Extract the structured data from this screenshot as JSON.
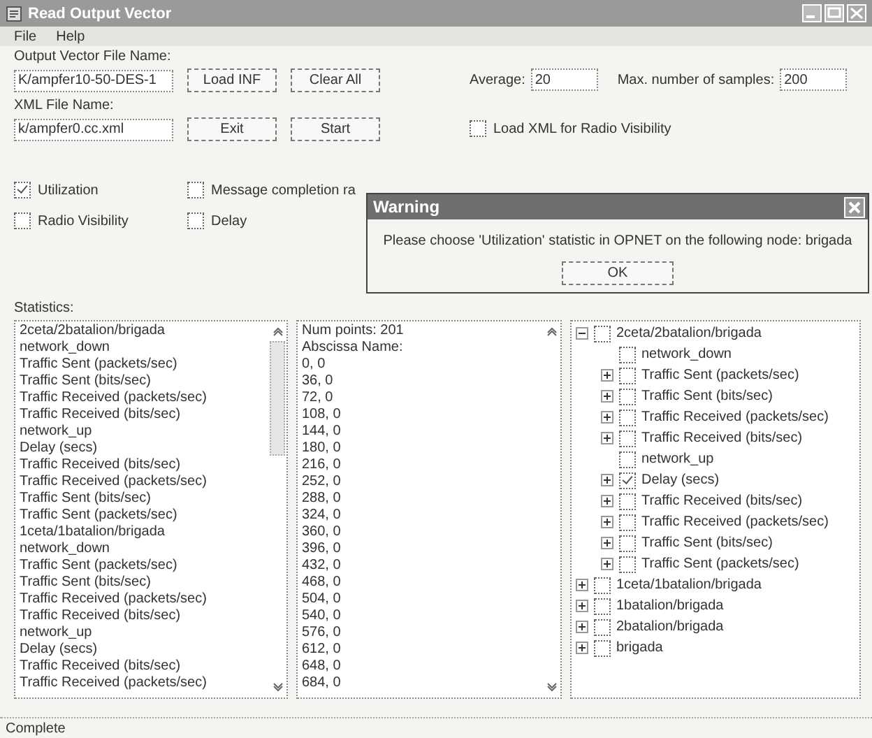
{
  "window": {
    "title": "Read Output Vector"
  },
  "menu": [
    "File",
    "Help"
  ],
  "output_vector": {
    "label": "Output Vector File Name:",
    "value": "K/ampfer10-50-DES-1"
  },
  "xml_file": {
    "label": "XML File Name:",
    "value": "k/ampfer0.cc.xml"
  },
  "buttons": [
    "Load INF",
    "Clear All",
    "Exit",
    "Start"
  ],
  "average": {
    "label": "Average:",
    "value": "20"
  },
  "max_samples": {
    "label": "Max. number of samples:",
    "value": "200"
  },
  "load_xml": {
    "label": "Load XML for Radio Visibility",
    "checked": false
  },
  "options": [
    {
      "label": "Utilization",
      "checked": true
    },
    {
      "label": "Message completion ra",
      "checked": false
    },
    {
      "label": "Radio Visibility",
      "checked": false
    },
    {
      "label": "Delay",
      "checked": false
    }
  ],
  "statistics": {
    "label": "Statistics:",
    "items": [
      "2ceta/2batalion/brigada",
      "network_down",
      "Traffic Sent (packets/sec)",
      "Traffic Sent (bits/sec)",
      "Traffic Received (packets/sec)",
      "Traffic Received (bits/sec)",
      "network_up",
      "Delay (secs)",
      "Traffic Received (bits/sec)",
      "Traffic Received (packets/sec)",
      "Traffic Sent (bits/sec)",
      "Traffic Sent (packets/sec)",
      "1ceta/1batalion/brigada",
      "network_down",
      "Traffic Sent (packets/sec)",
      "Traffic Sent (bits/sec)",
      "Traffic Received (packets/sec)",
      "Traffic Received (bits/sec)",
      "network_up",
      "Delay (secs)",
      "Traffic Received (bits/sec)",
      "Traffic Received (packets/sec)"
    ]
  },
  "values": [
    "Num points: 201",
    "Abscissa Name:",
    "0, 0",
    "36, 0",
    "72, 0",
    "108, 0",
    "144, 0",
    "180, 0",
    "216, 0",
    "252, 0",
    "288, 0",
    "324, 0",
    "360, 0",
    "396, 0",
    "432, 0",
    "468, 0",
    "504, 0",
    "540, 0",
    "576, 0",
    "612, 0",
    "648, 0",
    "684, 0"
  ],
  "tree": [
    {
      "label": "2ceta/2batalion/brigada",
      "kind": "group",
      "expanded": true,
      "checked": false,
      "children": [
        {
          "label": "network_down",
          "kind": "leaf",
          "checked": false
        },
        {
          "label": "Traffic Sent (packets/sec)",
          "kind": "group",
          "expanded": false,
          "checked": false
        },
        {
          "label": "Traffic Sent (bits/sec)",
          "kind": "group",
          "expanded": false,
          "checked": false
        },
        {
          "label": "Traffic Received (packets/sec)",
          "kind": "group",
          "expanded": false,
          "checked": false
        },
        {
          "label": "Traffic Received (bits/sec)",
          "kind": "group",
          "expanded": false,
          "checked": false
        },
        {
          "label": "network_up",
          "kind": "leaf",
          "checked": false
        },
        {
          "label": "Delay (secs)",
          "kind": "group",
          "expanded": false,
          "checked": true
        },
        {
          "label": "Traffic Received (bits/sec)",
          "kind": "group",
          "expanded": false,
          "checked": false
        },
        {
          "label": "Traffic Received (packets/sec)",
          "kind": "group",
          "expanded": false,
          "checked": false
        },
        {
          "label": "Traffic Sent (bits/sec)",
          "kind": "group",
          "expanded": false,
          "checked": false
        },
        {
          "label": "Traffic Sent (packets/sec)",
          "kind": "group",
          "expanded": false,
          "checked": false
        }
      ]
    },
    {
      "label": "1ceta/1batalion/brigada",
      "kind": "group",
      "expanded": false,
      "checked": false
    },
    {
      "label": "1batalion/brigada",
      "kind": "group",
      "expanded": false,
      "checked": false
    },
    {
      "label": "2batalion/brigada",
      "kind": "group",
      "expanded": false,
      "checked": false
    },
    {
      "label": "brigada",
      "kind": "group",
      "expanded": false,
      "checked": false
    }
  ],
  "status_bar": "Complete",
  "dialog": {
    "title": "Warning",
    "message": "Please choose 'Utilization' statistic in OPNET on the following node: brigada",
    "button": "OK"
  }
}
